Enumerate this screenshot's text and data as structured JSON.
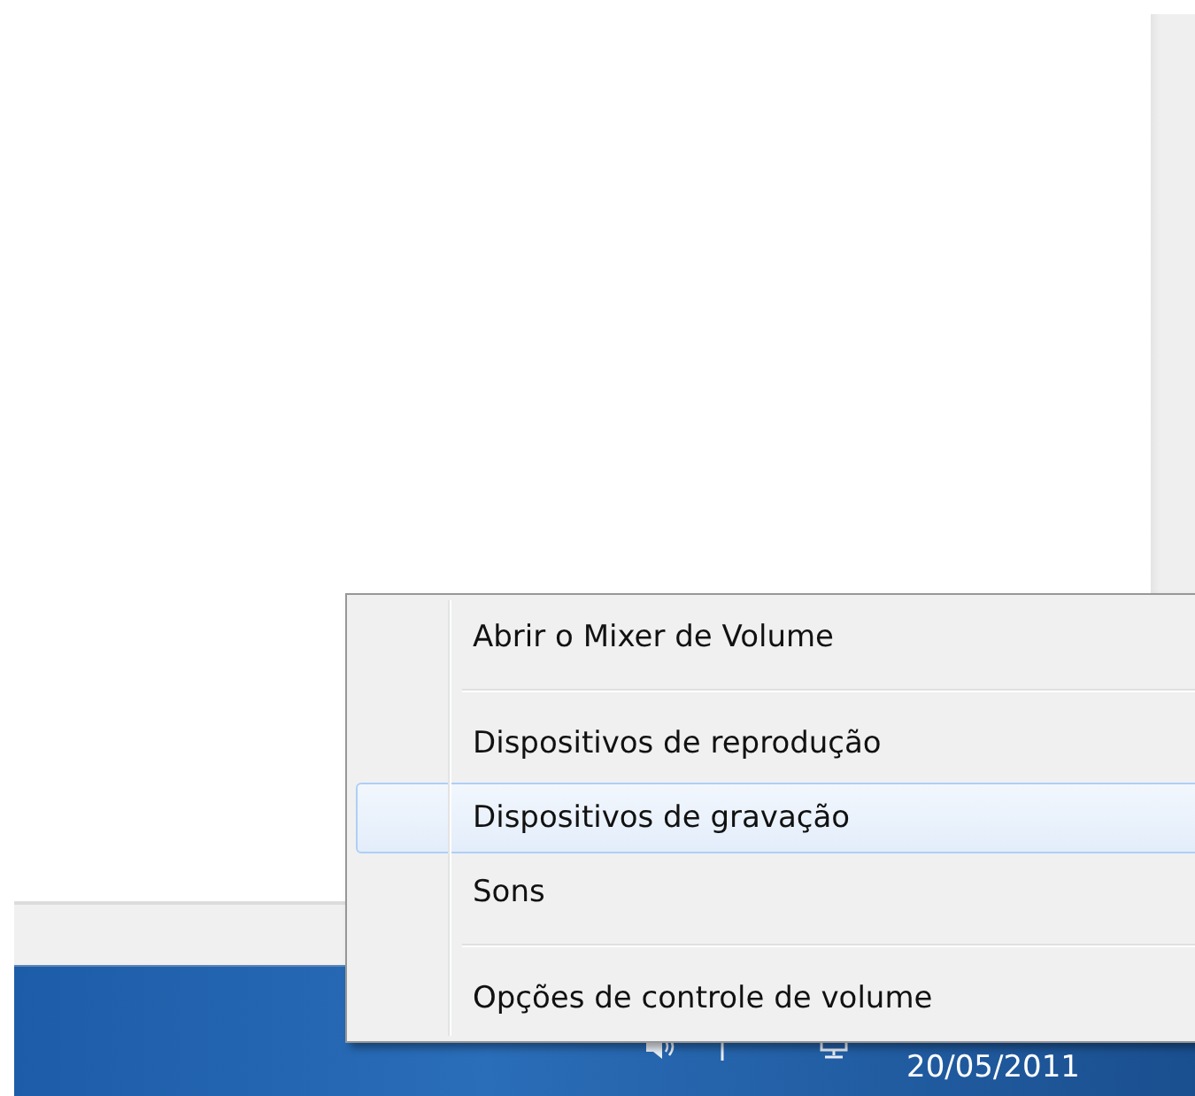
{
  "context_menu": {
    "items": [
      {
        "kind": "item",
        "label": "Abrir o Mixer de Volume",
        "selected": false
      },
      {
        "kind": "separator"
      },
      {
        "kind": "item",
        "label": "Dispositivos de reprodução",
        "selected": false
      },
      {
        "kind": "item",
        "label": "Dispositivos de gravação",
        "selected": true
      },
      {
        "kind": "item",
        "label": "Sons",
        "selected": false
      },
      {
        "kind": "separator"
      },
      {
        "kind": "item",
        "label": "Opções de controle de volume",
        "selected": false
      }
    ]
  },
  "taskbar": {
    "date": "20/05/2011"
  }
}
